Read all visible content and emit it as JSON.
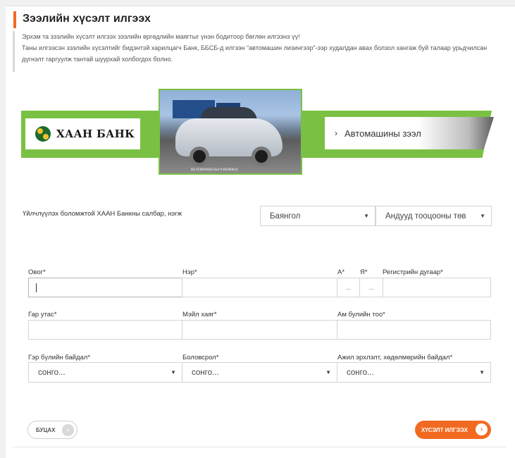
{
  "page": {
    "title": "Зээлийн хүсэлт илгээх",
    "intro_line1": "Эрхэм та зээлийн хүсэлт илгээх зээлийн өргөдлийн маягтыг үнэн бодитоор бөглөн илгээнэ үү!",
    "intro_line2": "Таны илгээсэн зээлийн хүсэлтийг бидэнтэй харилцагч Банк, ББСБ-д илгээн “автомашин лизингээр”-ээр худалдан авах болзол хангаж буй талаар урьдчилсан дүгнэлт гаргуулж тантай шуурхай холбогдох болно."
  },
  "banner": {
    "bank_name": "ХААН БАНК",
    "photo_caption": "BE FORWARD Ref # BF080024",
    "car_loan_label": "Автомашины зээл",
    "arrow": "›"
  },
  "branch": {
    "label": "Үйлчлүүлэх боломжтой ХААН Банкны салбар, нэгж",
    "district": "Баянгол",
    "unit": "Андууд тооцооны төв"
  },
  "form": {
    "surname_label": "Овог*",
    "name_label": "Нэр*",
    "reg_a_label": "А*",
    "reg_ya_label": "Я*",
    "register_label": "Регистрийн дугаар*",
    "reg_a_value": "...",
    "reg_ya_value": "...",
    "phone_label": "Гар утас*",
    "email_label": "Мэйл хаяг*",
    "family_count_label": "Ам булийн тоо*",
    "marital_label": "Гэр бүлийн байдал*",
    "marital_value": "сонго...",
    "education_label": "Боловсрол*",
    "education_value": "сонго...",
    "employment_label": "Ажил эрхлэлт, хөдөлмөрийн байдал*",
    "employment_value": "сонго..."
  },
  "buttons": {
    "back": "БУЦАХ",
    "back_icon": "‹",
    "submit": "ХҮСЭЛТ ИЛГЭЭХ",
    "submit_icon": "›"
  },
  "icons": {
    "caret": "▼"
  },
  "colors": {
    "accent": "#f26a21",
    "brand_green": "#7ac143"
  }
}
